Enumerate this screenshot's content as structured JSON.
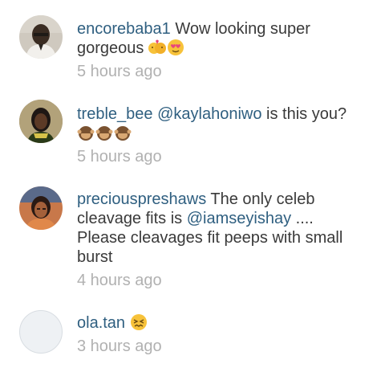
{
  "comments": [
    {
      "username": "encorebaba1",
      "text": " Wow looking super gorgeous ",
      "emojis": [
        "kissing-couple-emoji",
        "heart-eyes-emoji"
      ],
      "time": "5 hours ago",
      "avatar": "avatar-encorebaba1"
    },
    {
      "username": "treble_bee",
      "mention": "@kaylahoniwo",
      "text": " is this you? ",
      "emojis": [
        "see-no-evil-monkey-emoji",
        "see-no-evil-monkey-emoji",
        "see-no-evil-monkey-emoji"
      ],
      "time": "5 hours ago",
      "avatar": "avatar-treble-bee"
    },
    {
      "username": "preciouspreshaws",
      "text_before": " The only celeb cleavage fits is ",
      "mention": "@iamseyishay",
      "text_after": " .... Please cleavages fit peeps with small burst",
      "time": "4 hours ago",
      "avatar": "avatar-preciouspreshaws"
    },
    {
      "username": "ola.tan",
      "text": " ",
      "emojis": [
        "confounded-face-emoji"
      ],
      "time": "3 hours ago",
      "avatar": "avatar-placeholder"
    }
  ]
}
